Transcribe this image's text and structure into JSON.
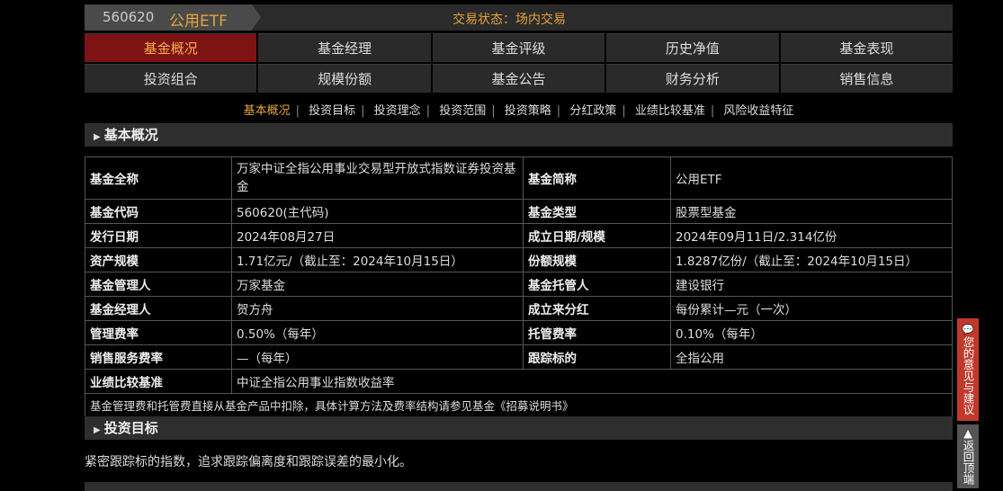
{
  "header": {
    "code": "560620",
    "name": "公用ETF",
    "status": "交易状态：场内交易"
  },
  "nav": {
    "row1": [
      "基金概况",
      "基金经理",
      "基金评级",
      "历史净值",
      "基金表现"
    ],
    "row2": [
      "投资组合",
      "规模份额",
      "基金公告",
      "财务分析",
      "销售信息"
    ],
    "active": "基金概况"
  },
  "sublinks": [
    "基本概况",
    "投资目标",
    "投资理念",
    "投资范围",
    "投资策略",
    "分红政策",
    "业绩比较基准",
    "风险收益特征"
  ],
  "sections": {
    "basic": "基本概况",
    "objective": "投资目标"
  },
  "table": {
    "full_name_label": "基金全称",
    "full_name": "万家中证全指公用事业交易型开放式指数证券投资基金",
    "short_name_label": "基金简称",
    "short_name": "公用ETF",
    "code_label": "基金代码",
    "code": "560620(主代码)",
    "type_label": "基金类型",
    "type": "股票型基金",
    "issue_date_label": "发行日期",
    "issue_date": "2024年08月27日",
    "established_label": "成立日期/规模",
    "established": "2024年09月11日/2.314亿份",
    "asset_label": "资产规模",
    "asset": "1.71亿元/（截止至：2024年10月15日）",
    "share_label": "份额规模",
    "share": "1.8287亿份/（截止至：2024年10月15日）",
    "manager_co_label": "基金管理人",
    "manager_co": "万家基金",
    "custodian_label": "基金托管人",
    "custodian": "建设银行",
    "manager_label": "基金经理人",
    "manager": "贺方舟",
    "dividend_label": "成立来分红",
    "dividend": "每份累计—元（一次）",
    "mgmt_fee_label": "管理费率",
    "mgmt_fee": "0.50%（每年）",
    "custody_fee_label": "托管费率",
    "custody_fee": "0.10%（每年）",
    "sales_fee_label": "销售服务费率",
    "sales_fee": "—（每年）",
    "tracking_label": "跟踪标的",
    "tracking": "全指公用",
    "benchmark_label": "业绩比较基准",
    "benchmark": "中证全指公用事业指数收益率",
    "note": "基金管理费和托管费直接从基金产品中扣除，具体计算方法及费率结构请参见基金《招募说明书》"
  },
  "objective_text": "紧密跟踪标的指数，追求跟踪偏离度和跟踪误差的最小化。",
  "side": {
    "feedback": "您的意见与建议",
    "top": "返回顶端"
  }
}
